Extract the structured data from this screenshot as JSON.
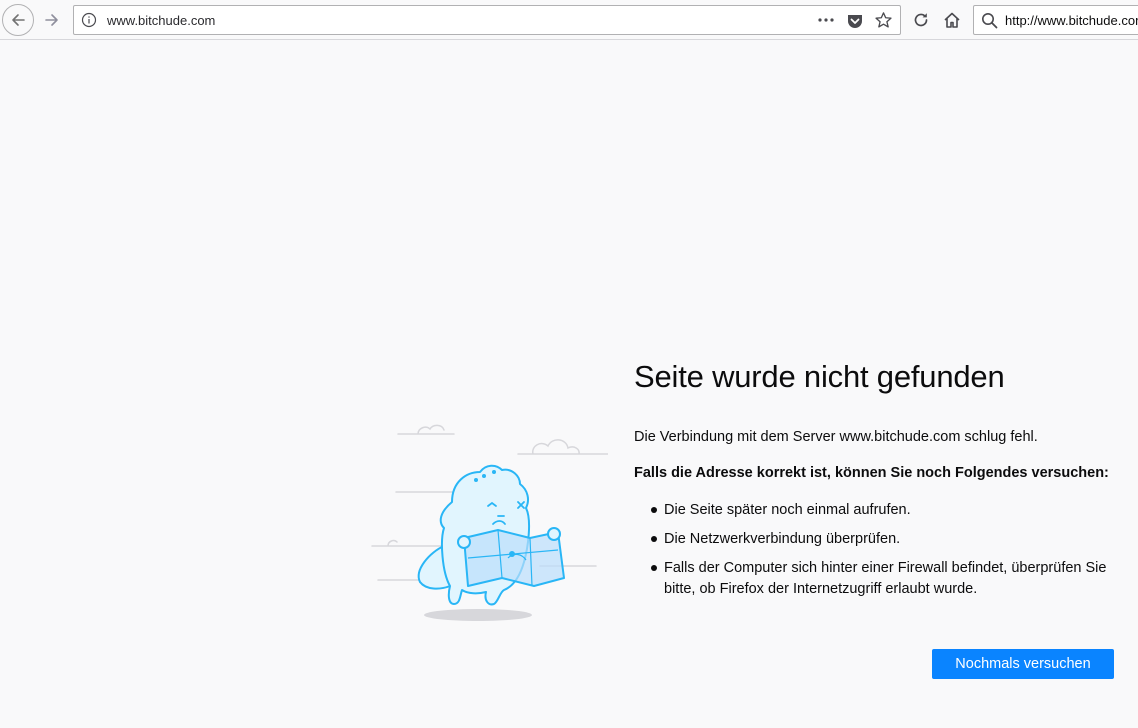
{
  "toolbar": {
    "back_icon": "back-arrow-icon",
    "forward_icon": "forward-arrow-icon",
    "url": "www.bitchude.com",
    "page_actions_icon": "more-dots-icon",
    "pocket_icon": "pocket-icon",
    "bookmark_icon": "star-icon",
    "reload_icon": "reload-icon",
    "home_icon": "home-icon",
    "search_icon": "search-icon",
    "search_text": "http://www.bitchude.com"
  },
  "error": {
    "illustration": "dinosaur-with-map-illustration",
    "title": "Seite wurde nicht gefunden",
    "description": "Die Verbindung mit dem Server www.bitchude.com schlug fehl.",
    "try_heading": "Falls die Adresse korrekt ist, können Sie noch Folgendes versuchen:",
    "suggestions": [
      "Die Seite später noch einmal aufrufen.",
      "Die Netzwerkverbindung überprüfen.",
      "Falls der Computer sich hinter einer Firewall befindet, überprüfen Sie bitte, ob Firefox der Internetzugriff erlaubt wurde."
    ],
    "retry_label": "Nochmals versuchen"
  },
  "colors": {
    "accent": "#0a84ff",
    "illustration": "#29b6f6",
    "page_bg": "#f9f9fa"
  }
}
